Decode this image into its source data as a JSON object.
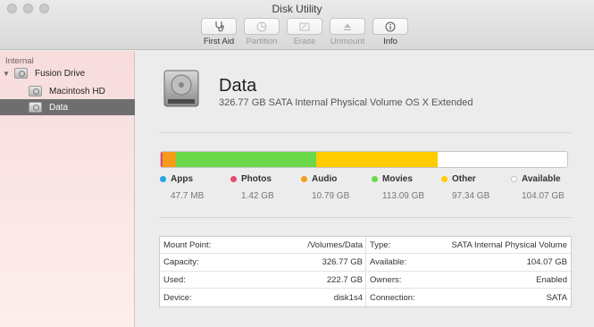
{
  "window": {
    "title": "Disk Utility"
  },
  "toolbar": [
    {
      "id": "first-aid",
      "label": "First Aid",
      "icon": "stethoscope-icon",
      "enabled": true
    },
    {
      "id": "partition",
      "label": "Partition",
      "icon": "pie-icon",
      "enabled": false
    },
    {
      "id": "erase",
      "label": "Erase",
      "icon": "erase-icon",
      "enabled": false
    },
    {
      "id": "unmount",
      "label": "Unmount",
      "icon": "eject-icon",
      "enabled": false
    },
    {
      "id": "info",
      "label": "Info",
      "icon": "info-icon",
      "enabled": true
    }
  ],
  "sidebar": {
    "section": "Internal",
    "items": [
      {
        "label": "Fusion Drive"
      },
      {
        "label": "Macintosh HD"
      },
      {
        "label": "Data"
      }
    ]
  },
  "volume": {
    "name": "Data",
    "description": "326.77 GB SATA Internal Physical Volume OS X Extended"
  },
  "usage": [
    {
      "name": "Apps",
      "size": "47.7 MB",
      "color": "#2aa3e6",
      "fraction": 0.0002
    },
    {
      "name": "Photos",
      "size": "1.42 GB",
      "color": "#e94b73",
      "fraction": 0.0043
    },
    {
      "name": "Audio",
      "size": "10.79 GB",
      "color": "#f59d1a",
      "fraction": 0.033
    },
    {
      "name": "Movies",
      "size": "113.09 GB",
      "color": "#6bd84a",
      "fraction": 0.346
    },
    {
      "name": "Other",
      "size": "97.34 GB",
      "color": "#ffcc00",
      "fraction": 0.298
    },
    {
      "name": "Available",
      "size": "104.07 GB",
      "color": "#ffffff",
      "fraction": 0.3185
    }
  ],
  "info": {
    "left": [
      {
        "key": "Mount Point:",
        "value": "/Volumes/Data"
      },
      {
        "key": "Capacity:",
        "value": "326.77 GB"
      },
      {
        "key": "Used:",
        "value": "222.7 GB"
      },
      {
        "key": "Device:",
        "value": "disk1s4"
      }
    ],
    "right": [
      {
        "key": "Type:",
        "value": "SATA Internal Physical Volume"
      },
      {
        "key": "Available:",
        "value": "104.07 GB"
      },
      {
        "key": "Owners:",
        "value": "Enabled"
      },
      {
        "key": "Connection:",
        "value": "SATA"
      }
    ]
  }
}
